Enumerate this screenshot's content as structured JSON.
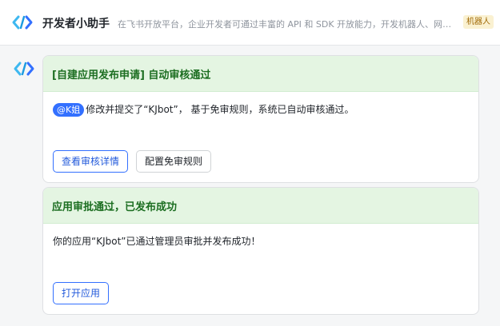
{
  "header": {
    "title": "开发者小助手",
    "description": "在飞书开放平台，企业开发者可通过丰富的 API 和 SDK 开放能力，开发机器人、网页...",
    "badge": "机器人"
  },
  "colors": {
    "accent": "#3370ff",
    "card_header_bg": "#e4f5e2",
    "card_title": "#1c6e21",
    "badge_bg": "#faf1d1"
  },
  "messages": [
    {
      "title": "[自建应用发布申请] 自动审核通过",
      "mention": "@K姐",
      "body": "修改并提交了“KJbot”， 基于免审规则，系统已自动审核通过。",
      "buttons": [
        "查看审核详情",
        "配置免审规则"
      ]
    },
    {
      "title": "应用审批通过，已发布成功",
      "body": "你的应用“KJbot”已通过管理员审批并发布成功！",
      "buttons": [
        "打开应用"
      ]
    }
  ]
}
